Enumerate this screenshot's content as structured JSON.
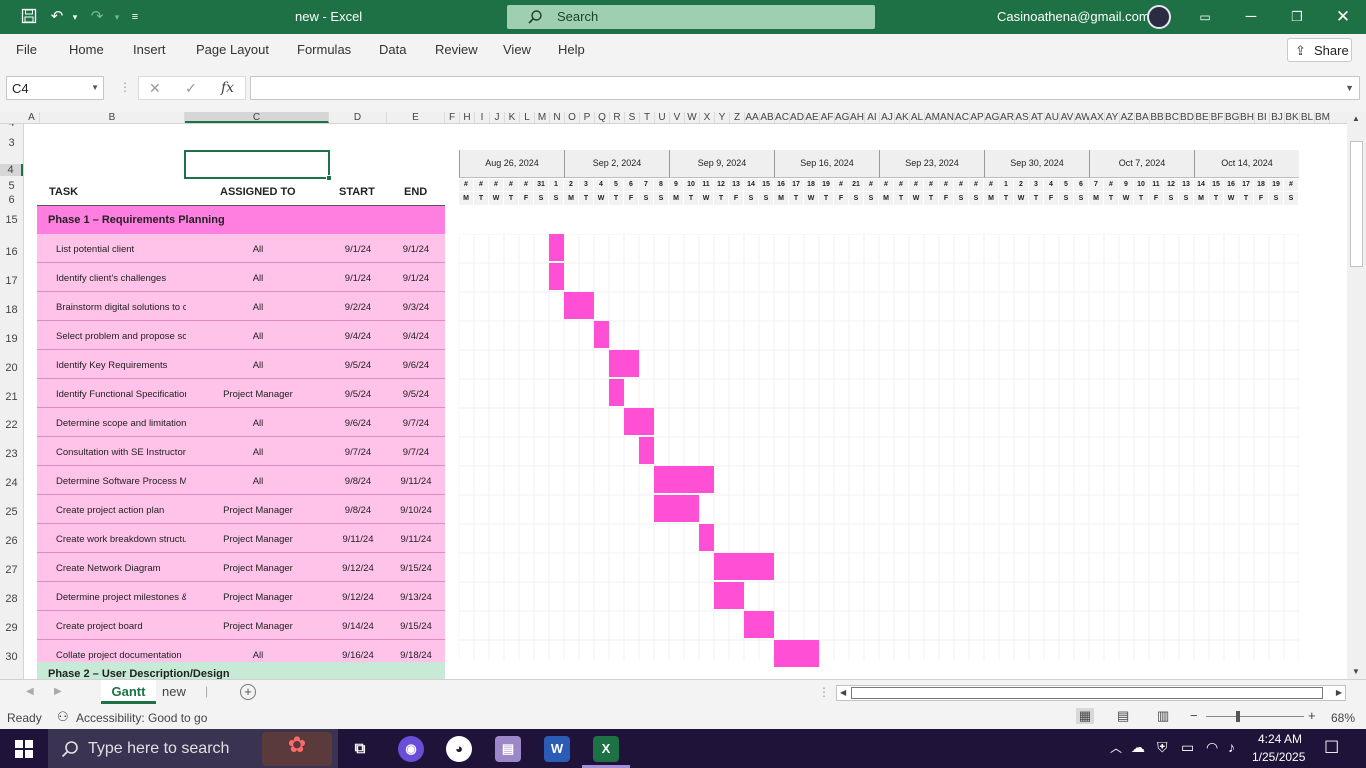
{
  "window": {
    "title": "new  -  Excel",
    "search_placeholder": "Search",
    "account": "Casinoathena@gmail.com"
  },
  "menu": [
    "File",
    "Home",
    "Insert",
    "Page Layout",
    "Formulas",
    "Data",
    "Review",
    "View",
    "Help"
  ],
  "share_label": "Share",
  "formula_bar": {
    "name_box": "C4",
    "fx": "fx",
    "value": ""
  },
  "column_headers": [
    "A",
    "B",
    "C",
    "D",
    "E",
    "F",
    "H",
    "I",
    "J",
    "K",
    "L",
    "M",
    "N",
    "O",
    "P",
    "Q",
    "R",
    "S",
    "T",
    "U",
    "V",
    "W",
    "X",
    "Y",
    "Z",
    "AA",
    "AB",
    "AC",
    "AD",
    "AE",
    "AF",
    "AG",
    "AH",
    "AI",
    "AJ",
    "AK",
    "AL",
    "AM",
    "AN",
    "AC",
    "AP",
    "AG",
    "AR",
    "AS",
    "AT",
    "AU",
    "AV",
    "AW",
    "AX",
    "AY",
    "AZ",
    "BA",
    "BB",
    "BC",
    "BD",
    "BE",
    "BF",
    "BG",
    "BH",
    "BI",
    "BJ",
    "BK",
    "BL",
    "BM"
  ],
  "row_numbers": [
    "4",
    "3",
    "4",
    "5",
    "6",
    "15",
    "16",
    "17",
    "18",
    "19",
    "20",
    "21",
    "22",
    "23",
    "24",
    "25",
    "26",
    "27",
    "28",
    "29",
    "30"
  ],
  "table_headers": {
    "task": "TASK",
    "assigned": "ASSIGNED TO",
    "start": "START",
    "end": "END"
  },
  "phase1": "Phase 1 – Requirements Planning",
  "phase2": "Phase 2 – User Description/Design",
  "tasks": [
    {
      "task": "List potential client",
      "assigned": "All",
      "start": "9/1/24",
      "end": "9/1/24"
    },
    {
      "task": "Identify client's challenges",
      "assigned": "All",
      "start": "9/1/24",
      "end": "9/1/24"
    },
    {
      "task": "Brainstorm digital solutions to c",
      "assigned": "All",
      "start": "9/2/24",
      "end": "9/3/24"
    },
    {
      "task": "Select problem and propose so",
      "assigned": "All",
      "start": "9/4/24",
      "end": "9/4/24"
    },
    {
      "task": "Identify Key Requirements",
      "assigned": "All",
      "start": "9/5/24",
      "end": "9/6/24"
    },
    {
      "task": "Identify Functional Specificatior",
      "assigned": "Project Manager",
      "start": "9/5/24",
      "end": "9/5/24"
    },
    {
      "task": "Determine scope and limitation",
      "assigned": "All",
      "start": "9/6/24",
      "end": "9/7/24"
    },
    {
      "task": "Consultation with SE Instructor",
      "assigned": "All",
      "start": "9/7/24",
      "end": "9/7/24"
    },
    {
      "task": "Determine Software Process M",
      "assigned": "All",
      "start": "9/8/24",
      "end": "9/11/24"
    },
    {
      "task": "Create project action plan",
      "assigned": "Project Manager",
      "start": "9/8/24",
      "end": "9/10/24"
    },
    {
      "task": "Create work breakdown structu",
      "assigned": "Project Manager",
      "start": "9/11/24",
      "end": "9/11/24"
    },
    {
      "task": "Create Network Diagram",
      "assigned": "Project Manager",
      "start": "9/12/24",
      "end": "9/15/24"
    },
    {
      "task": "Determine project milestones &",
      "assigned": "Project Manager",
      "start": "9/12/24",
      "end": "9/13/24"
    },
    {
      "task": "Create project board",
      "assigned": "Project Manager",
      "start": "9/14/24",
      "end": "9/15/24"
    },
    {
      "task": "Collate project documentation",
      "assigned": "All",
      "start": "9/16/24",
      "end": "9/18/24"
    }
  ],
  "week_labels": [
    "Aug 26, 2024",
    "Sep 2, 2024",
    "Sep 9, 2024",
    "Sep 16, 2024",
    "Sep 23, 2024",
    "Sep 30, 2024",
    "Oct 7, 2024",
    "Oct 14, 2024"
  ],
  "day_numbers": [
    "#",
    "#",
    "#",
    "#",
    "#",
    "31",
    "1",
    "2",
    "3",
    "4",
    "5",
    "6",
    "7",
    "8",
    "9",
    "10",
    "11",
    "12",
    "13",
    "14",
    "15",
    "16",
    "17",
    "18",
    "19",
    "#",
    "21",
    "#",
    "#",
    "#",
    "#",
    "#",
    "#",
    "#",
    "#",
    "#",
    "1",
    "2",
    "3",
    "4",
    "5",
    "6",
    "7",
    "#",
    "9",
    "10",
    "11",
    "12",
    "13",
    "14",
    "15",
    "16",
    "17",
    "18",
    "19",
    "#"
  ],
  "day_letters": [
    "M",
    "T",
    "W",
    "T",
    "F",
    "S",
    "S"
  ],
  "gantt": {
    "chart_start": "8/26/24",
    "bar_color": "#ff4fd4"
  },
  "sheet_tabs": [
    "Gantt",
    "new"
  ],
  "status": {
    "ready": "Ready",
    "accessibility": "Accessibility: Good to go",
    "zoom": "68%"
  },
  "taskbar": {
    "search_placeholder": "Type here to search",
    "time": "4:24 AM",
    "date": "1/25/2025"
  }
}
